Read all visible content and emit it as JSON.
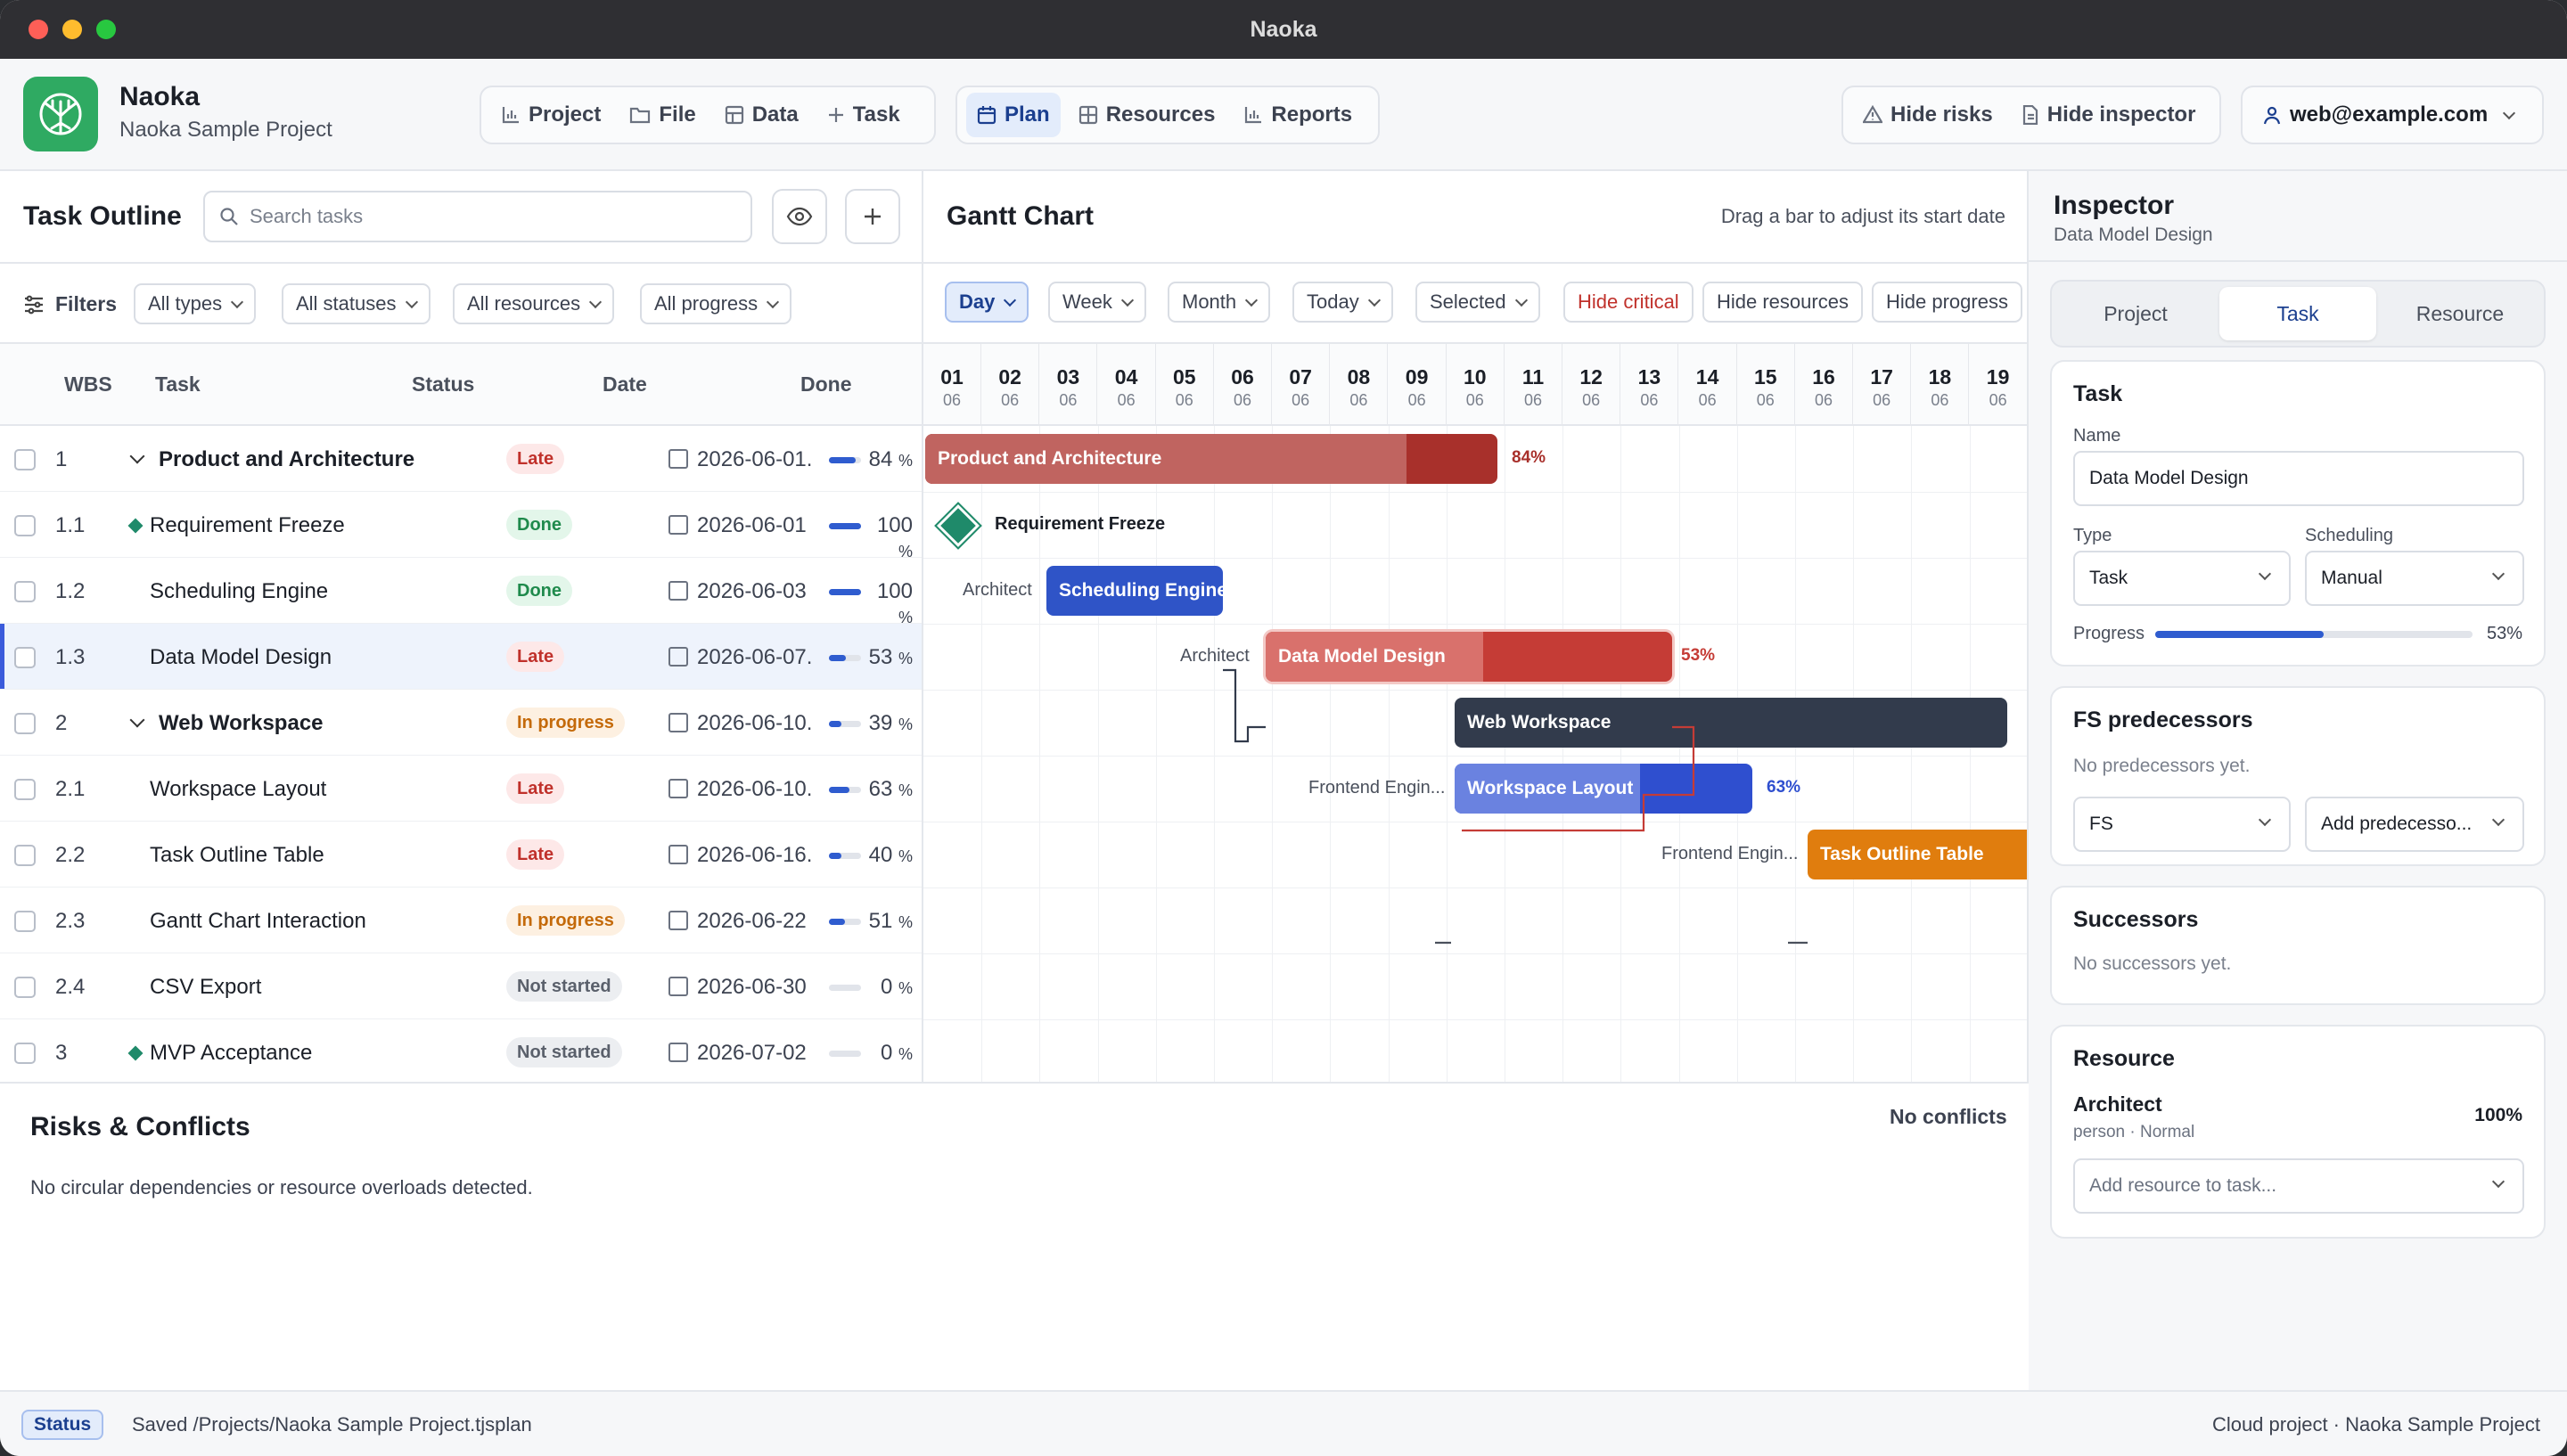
{
  "window": {
    "title": "Naoka"
  },
  "app": {
    "name": "Naoka",
    "project": "Naoka Sample Project"
  },
  "menu": {
    "project": "Project",
    "file": "File",
    "data": "Data",
    "task": "Task"
  },
  "views": {
    "plan": "Plan",
    "resources": "Resources",
    "reports": "Reports",
    "active": "Plan"
  },
  "actions": {
    "hide_risks": "Hide risks",
    "hide_inspector": "Hide inspector"
  },
  "user": {
    "email": "web@example.com"
  },
  "outline": {
    "title": "Task Outline",
    "search_placeholder": "Search tasks",
    "filters_label": "Filters",
    "filters": {
      "types": "All types",
      "statuses": "All statuses",
      "resources": "All resources",
      "progress": "All progress"
    },
    "columns": {
      "wbs": "WBS",
      "task": "Task",
      "status": "Status",
      "date": "Date",
      "done": "Done"
    },
    "rows": [
      {
        "wbs": "1",
        "name": "Product and Architecture",
        "status": "Late",
        "date": "2026-06-01.",
        "done": 84,
        "done_label": "84",
        "bold": true,
        "expander": true
      },
      {
        "wbs": "1.1",
        "name": "Requirement Freeze",
        "status": "Done",
        "date": "2026-06-01",
        "done": 100,
        "done_label": "100",
        "milestone": true
      },
      {
        "wbs": "1.2",
        "name": "Scheduling Engine",
        "status": "Done",
        "date": "2026-06-03",
        "done": 100,
        "done_label": "100"
      },
      {
        "wbs": "1.3",
        "name": "Data Model Design",
        "status": "Late",
        "date": "2026-06-07.",
        "done": 53,
        "done_label": "53",
        "selected": true
      },
      {
        "wbs": "2",
        "name": "Web Workspace",
        "status": "In progress",
        "date": "2026-06-10.",
        "done": 39,
        "done_label": "39",
        "bold": true,
        "expander": true
      },
      {
        "wbs": "2.1",
        "name": "Workspace Layout",
        "status": "Late",
        "date": "2026-06-10.",
        "done": 63,
        "done_label": "63"
      },
      {
        "wbs": "2.2",
        "name": "Task Outline Table",
        "status": "Late",
        "date": "2026-06-16.",
        "done": 40,
        "done_label": "40"
      },
      {
        "wbs": "2.3",
        "name": "Gantt Chart Interaction",
        "status": "In progress",
        "date": "2026-06-22",
        "done": 51,
        "done_label": "51"
      },
      {
        "wbs": "2.4",
        "name": "CSV Export",
        "status": "Not started",
        "date": "2026-06-30",
        "done": 0,
        "done_label": "0"
      },
      {
        "wbs": "3",
        "name": "MVP Acceptance",
        "status": "Not started",
        "date": "2026-07-02",
        "done": 0,
        "done_label": "0",
        "milestone": true
      }
    ],
    "pct_symbol": "%"
  },
  "gantt": {
    "title": "Gantt Chart",
    "hint": "Drag a bar to adjust its start date",
    "controls": {
      "day": "Day",
      "week": "Week",
      "month": "Month",
      "today": "Today",
      "selected": "Selected",
      "hide_critical": "Hide critical",
      "hide_resources": "Hide resources",
      "hide_progress": "Hide progress"
    },
    "days": [
      "01",
      "02",
      "03",
      "04",
      "05",
      "06",
      "07",
      "08",
      "09",
      "10",
      "11",
      "12",
      "13",
      "14",
      "15",
      "16",
      "17",
      "18",
      "19"
    ],
    "month": "06",
    "bars": [
      {
        "label": "Product and Architecture",
        "pct_label": "84%",
        "color": "#a8302b",
        "fill": "#c06460"
      },
      {
        "label": "Requirement Freeze",
        "color": "#1f8a6a"
      },
      {
        "label": "Scheduling Engine",
        "resource": "Architect",
        "color": "#2f54c7"
      },
      {
        "label": "Data Model Design",
        "resource": "Architect",
        "pct_label": "53%",
        "color": "#c53c36",
        "fill": "#d9716c"
      },
      {
        "label": "Web Workspace",
        "color": "#323b4c"
      },
      {
        "label": "Workspace Layout",
        "resource": "Frontend Engin...",
        "pct_label": "63%",
        "color": "#2f4fcf",
        "fill": "#6a82e0"
      },
      {
        "label": "Task Outline Table",
        "resource": "Frontend Engin...",
        "color": "#e07d0e"
      }
    ]
  },
  "risks": {
    "title": "Risks & Conflicts",
    "status": "No conflicts",
    "message": "No circular dependencies or resource overloads detected."
  },
  "inspector": {
    "title": "Inspector",
    "subtitle": "Data Model Design",
    "tabs": {
      "project": "Project",
      "task": "Task",
      "resource": "Resource",
      "active": "Task"
    },
    "task": {
      "heading": "Task",
      "name_label": "Name",
      "name": "Data Model Design",
      "type_label": "Type",
      "type": "Task",
      "scheduling_label": "Scheduling",
      "scheduling": "Manual",
      "progress_label": "Progress",
      "progress": 53,
      "progress_text": "53%"
    },
    "predecessors": {
      "heading": "FS predecessors",
      "empty": "No predecessors yet.",
      "type": "FS",
      "add": "Add predecesso..."
    },
    "successors": {
      "heading": "Successors",
      "empty": "No successors yet."
    },
    "resource": {
      "heading": "Resource",
      "name": "Architect",
      "meta": "person · Normal",
      "alloc": "100%",
      "add": "Add resource to task..."
    }
  },
  "statusbar": {
    "badge": "Status",
    "message": "Saved /Projects/Naoka Sample Project.tjsplan",
    "right": "Cloud project · Naoka Sample Project"
  }
}
